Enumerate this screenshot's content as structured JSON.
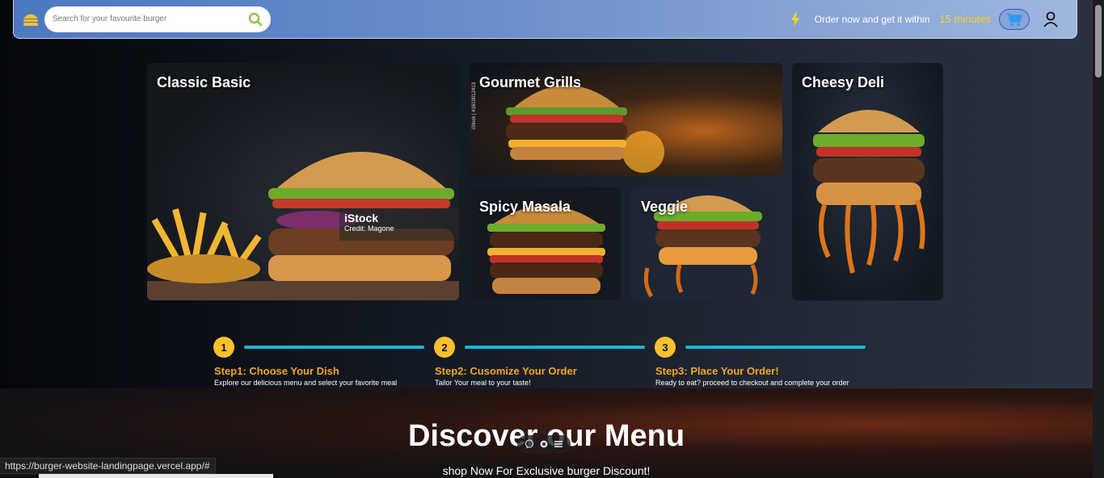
{
  "header": {
    "search_placeholder": "Search for your favourite burger",
    "order_text": "Order now and get it within",
    "minutes": "15 minutes"
  },
  "categories": [
    {
      "label": "Classic Basic"
    },
    {
      "label": "Gourmet Grills"
    },
    {
      "label": "Spicy Masala"
    },
    {
      "label": "Veggie"
    },
    {
      "label": "Cheesy Deli"
    }
  ],
  "watermark": {
    "brand": "iStock",
    "credit": "Credit: Magone",
    "side_credit": "iStock | #1619012413"
  },
  "steps": [
    {
      "number": "1",
      "title": "Step1: Choose Your Dish",
      "desc": "Explore our delicious menu and select your favorite meal"
    },
    {
      "number": "2",
      "title": "Step2: Cusomize Your Order",
      "desc": "Tailor Your meal to your taste!"
    },
    {
      "number": "3",
      "title": "Step3: Place Your Order!",
      "desc": "Ready to eat? proceed to checkout and complete your order"
    }
  ],
  "discover": {
    "title": "Discover our Menu",
    "subtitle": "shop Now For Exclusive burger Discount!"
  },
  "status_url": "https://burger-website-landingpage.vercel.app/#",
  "colors": {
    "accent_yellow": "#fbc02d",
    "step_title": "#f5a623",
    "step_line": "#18b7d6",
    "header_gradient_start": "#4d79c0"
  },
  "icons": {
    "logo": "burger-icon",
    "search": "search-icon",
    "bolt": "bolt-icon",
    "cart": "cart-icon",
    "user": "user-icon"
  }
}
